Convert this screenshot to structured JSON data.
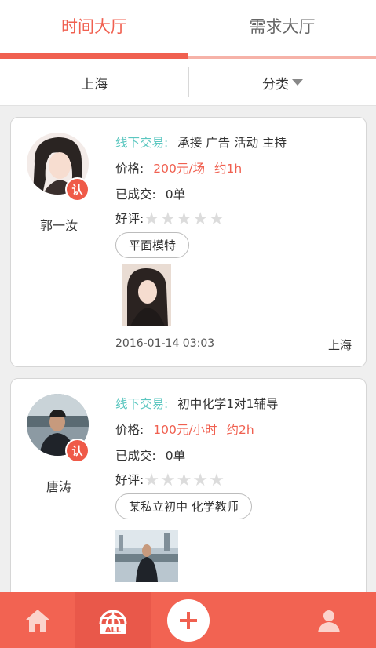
{
  "tabs": {
    "left": "时间大厅",
    "right": "需求大厅"
  },
  "filters": {
    "city": "上海",
    "category": "分类"
  },
  "cards": [
    {
      "name": "郭一汝",
      "badge": "认",
      "mode_label": "线下交易:",
      "services": "承接 广告 活动 主持",
      "price_label": "价格:",
      "price": "200元/场",
      "duration": "约1h",
      "deals_label": "已成交:",
      "deals": "0单",
      "rating_label": "好评:",
      "stars": "★★★★★",
      "tag": "平面模特",
      "date": "2016-01-14 03:03",
      "location": "上海"
    },
    {
      "name": "唐涛",
      "badge": "认",
      "mode_label": "线下交易:",
      "services": "初中化学1对1辅导",
      "price_label": "价格:",
      "price": "100元/小时",
      "duration": "约2h",
      "deals_label": "已成交:",
      "deals": "0单",
      "rating_label": "好评:",
      "stars": "★★★★★",
      "tag": "某私立初中 化学教师"
    }
  ],
  "bottom_nav": {
    "home_icon": "home-icon",
    "all_icon": "all-icon",
    "all_label": "ALL",
    "add_icon": "plus-icon",
    "profile_icon": "person-icon"
  },
  "colors": {
    "accent": "#f06050",
    "teal": "#5cc7c0",
    "bar": "#f26352"
  }
}
